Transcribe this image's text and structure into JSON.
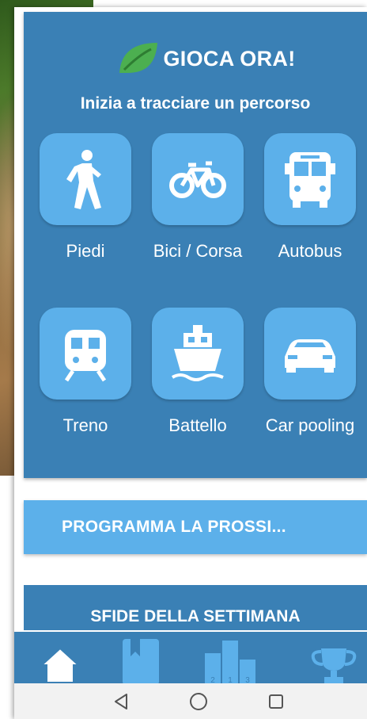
{
  "play": {
    "title": "GIOCA ORA!",
    "subtitle": "Inizia a tracciare un percorso"
  },
  "modes": [
    {
      "id": "walk",
      "label": "Piedi",
      "icon": "walking-person-icon"
    },
    {
      "id": "bike",
      "label": "Bici / Corsa",
      "icon": "bicycle-icon"
    },
    {
      "id": "bus",
      "label": "Autobus",
      "icon": "bus-icon"
    },
    {
      "id": "train",
      "label": "Treno",
      "icon": "train-icon"
    },
    {
      "id": "boat",
      "label": "Battello",
      "icon": "ferry-icon"
    },
    {
      "id": "carpool",
      "label": "Car pooling",
      "icon": "car-icon"
    }
  ],
  "plan_button": {
    "label": "PROGRAMMA LA PROSSI..."
  },
  "challenges": {
    "title": "SFIDE DELLA SETTIMANA"
  },
  "tabs": [
    {
      "id": "home",
      "icon": "home-icon"
    },
    {
      "id": "diary",
      "icon": "book-icon"
    },
    {
      "id": "ranking",
      "icon": "podium-icon"
    },
    {
      "id": "trophy",
      "icon": "trophy-icon"
    }
  ],
  "podium_numbers": [
    "2",
    "1",
    "3"
  ],
  "system_nav": [
    "back-icon",
    "home-circle-icon",
    "recents-icon"
  ],
  "colors": {
    "card": "#3a80b5",
    "tile": "#5cb0ea",
    "leaf": "#4caf50",
    "text": "#ffffff",
    "nav_bg": "#f2f2f2"
  }
}
